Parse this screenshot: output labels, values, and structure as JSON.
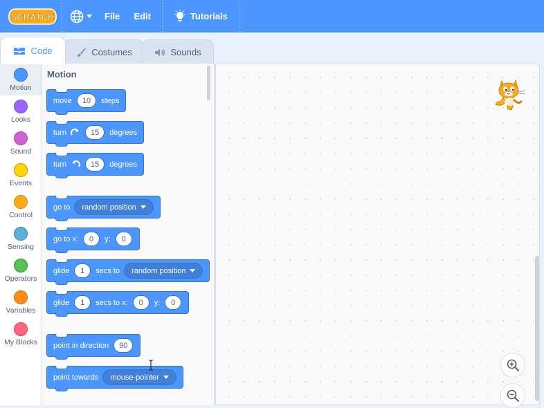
{
  "menubar": {
    "logo_text": "SCRATCH",
    "file_label": "File",
    "edit_label": "Edit",
    "tutorials_label": "Tutorials",
    "language_icon": "globe-icon"
  },
  "tabs": [
    {
      "label": "Code",
      "icon": "code-icon",
      "active": true
    },
    {
      "label": "Costumes",
      "icon": "brush-icon",
      "active": false
    },
    {
      "label": "Sounds",
      "icon": "speaker-icon",
      "active": false
    }
  ],
  "categories": [
    {
      "label": "Motion",
      "color": "#4c97ff"
    },
    {
      "label": "Looks",
      "color": "#9966ff"
    },
    {
      "label": "Sound",
      "color": "#cf63cf"
    },
    {
      "label": "Events",
      "color": "#ffd500"
    },
    {
      "label": "Control",
      "color": "#ffab19"
    },
    {
      "label": "Sensing",
      "color": "#5cb1d6"
    },
    {
      "label": "Operators",
      "color": "#59c059"
    },
    {
      "label": "Variables",
      "color": "#ff8c1a"
    },
    {
      "label": "My Blocks",
      "color": "#ff6680"
    }
  ],
  "palette": {
    "title": "Motion",
    "blocks": {
      "move": {
        "label": "move",
        "value": "10",
        "suffix": "steps"
      },
      "turn_right": {
        "label": "turn",
        "value": "15",
        "suffix": "degrees"
      },
      "turn_left": {
        "label": "turn",
        "value": "15",
        "suffix": "degrees"
      },
      "go_to": {
        "label": "go to",
        "dropdown": "random position"
      },
      "go_to_xy": {
        "label": "go to x:",
        "x": "0",
        "y_label": "y:",
        "y": "0"
      },
      "glide_to": {
        "label": "glide",
        "value": "1",
        "mid": "secs to",
        "dropdown": "random position"
      },
      "glide_xy": {
        "label": "glide",
        "value": "1",
        "mid": "secs to x:",
        "x": "0",
        "y_label": "y:",
        "y": "0"
      },
      "point_direction": {
        "label": "point in direction",
        "value": "90"
      },
      "point_towards": {
        "label": "point towards",
        "dropdown": "mouse-pointer"
      }
    }
  },
  "colors": {
    "accent": "#4c97ff",
    "motion_block": "#4c97ff",
    "motion_border": "#3373cc"
  }
}
